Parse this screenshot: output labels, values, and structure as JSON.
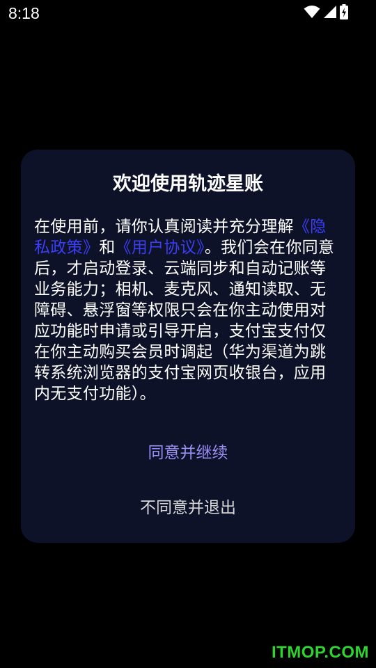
{
  "status_bar": {
    "time": "8:18",
    "icons": [
      "wifi-icon",
      "signal-icon",
      "battery-charging-icon"
    ],
    "color": "#ffffff"
  },
  "dialog": {
    "title": "欢迎使用轨迹星账",
    "body": {
      "intro": "在使用前，请你认真阅读并充分理解",
      "privacy_link": "《隐私政策》",
      "and": "和",
      "agreement_link": "《用户协议》",
      "details": "。我们会在你同意后，才启动登录、云端同步和自动记账等业务能力；相机、麦克风、通知读取、无障碍、悬浮窗等权限只会在你主动使用对应功能时申请或引导开启，支付宝支付仅在你主动购买会员时调起（华为渠道为跳转系统浏览器的支付宝网页收银台，应用内无支付功能）。"
    },
    "agree_label": "同意并继续",
    "disagree_label": "不同意并退出",
    "colors": {
      "background": "#0d1229",
      "link": "#3b3ef5",
      "agree": "#9b8ef5",
      "disagree": "#d8d8d8"
    }
  },
  "watermark": {
    "text": "ITMOP.COM",
    "color": "#2fd32f"
  }
}
